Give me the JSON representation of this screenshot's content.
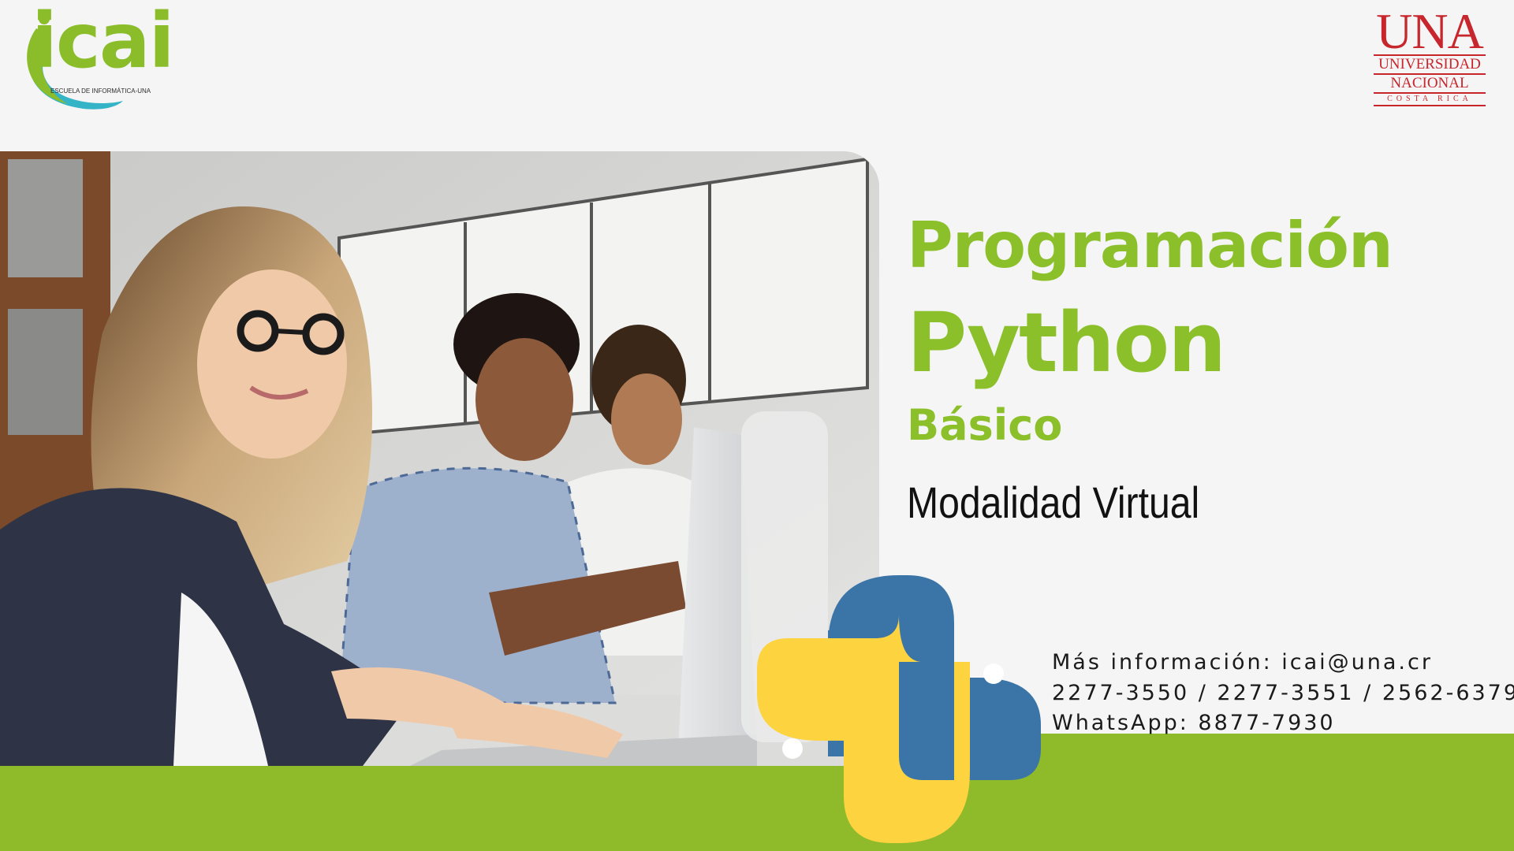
{
  "logos": {
    "icai": {
      "wordmark": "icai",
      "tagline": "ESCUELA DE INFORMÁTICA-UNA",
      "green": "#8bbd2b",
      "teal": "#34b4c6"
    },
    "una": {
      "acronym": "UNA",
      "line1": "UNIVERSIDAD",
      "line2": "NACIONAL",
      "line3": "COSTA RICA",
      "color": "#c6262c"
    }
  },
  "photo": {
    "subject": "photo-students-at-laptops"
  },
  "course": {
    "title_line1": "Programación",
    "title_line2": "Python",
    "title_line3": "Básico",
    "modality": "Modalidad Virtual",
    "accent_color": "#8cc02b"
  },
  "contact": {
    "line1": "Más información: icai@una.cr",
    "line2": "2277-3550 / 2277-3551 / 2562-6379",
    "line3": "WhatsApp: 8877-7930"
  },
  "python_logo": {
    "icon": "python-logo-icon",
    "blue": "#3b75a8",
    "yellow": "#fdd33f"
  },
  "colors": {
    "background": "#f5f5f6",
    "band": "#8fba29"
  }
}
